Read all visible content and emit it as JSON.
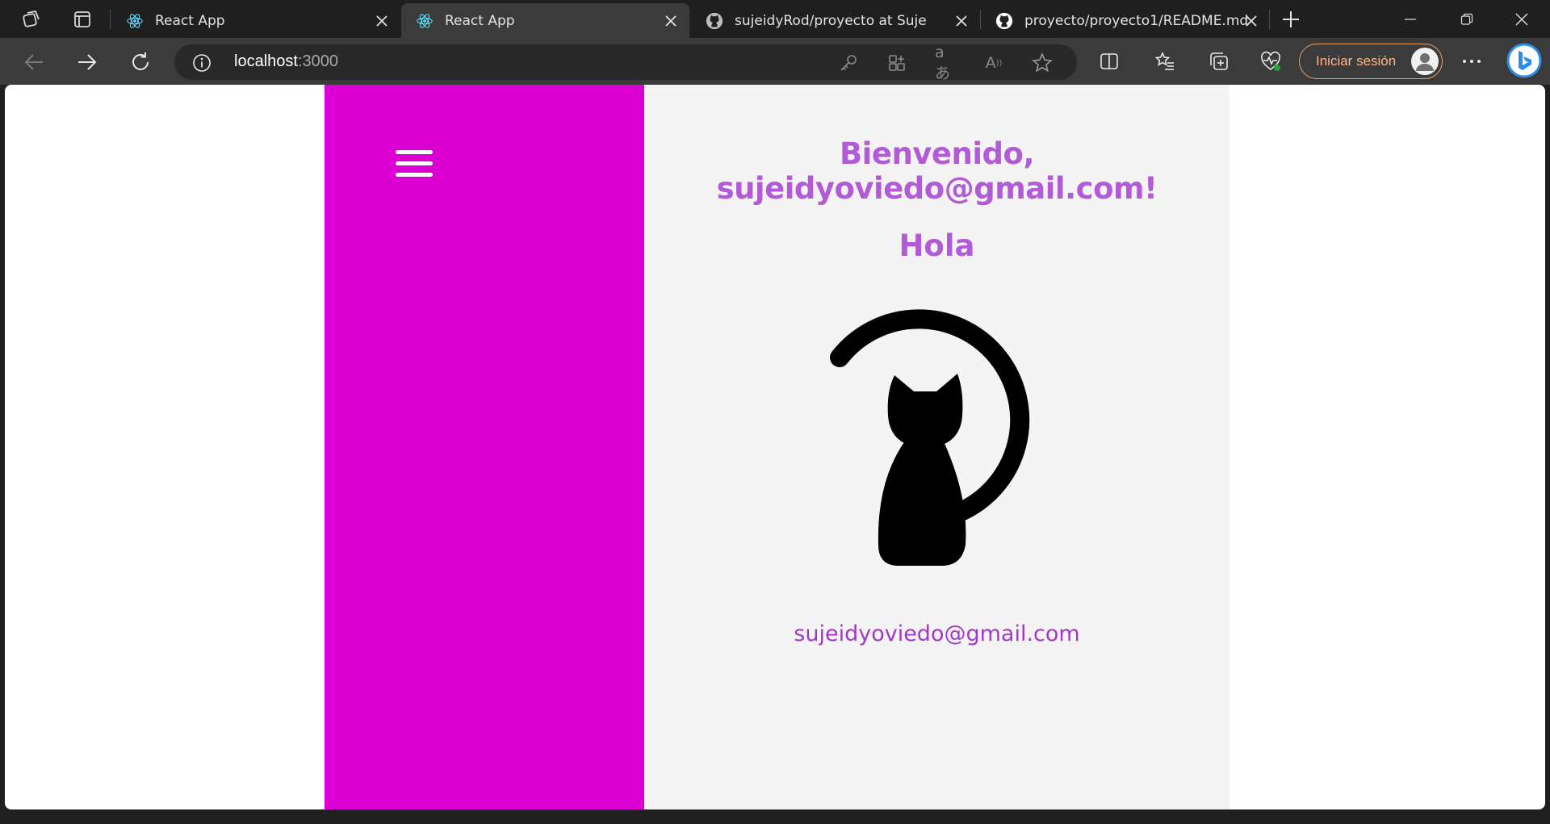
{
  "browser": {
    "tabs": [
      {
        "title": "React App",
        "favicon": "react-icon",
        "active": false
      },
      {
        "title": "React App",
        "favicon": "react-icon",
        "active": true
      },
      {
        "title": "sujeidyRod/proyecto at Suje",
        "favicon": "github-icon",
        "active": false
      },
      {
        "title": "proyecto/proyecto1/README.md",
        "favicon": "github-icon",
        "active": false
      }
    ],
    "url_host": "localhost",
    "url_port": ":3000",
    "signin_label": "Iniciar sesión"
  },
  "page": {
    "welcome": "Bienvenido, sujeidyoviedo@gmail.com!",
    "greeting": "Hola",
    "email": "sujeidyoviedo@gmail.com",
    "logo_icon": "cat-icon"
  },
  "colors": {
    "sidebar": "#da00d3",
    "heading": "#b35ad6",
    "email": "#a438c8",
    "content_bg": "#f4f4f4",
    "signin_border": "#e8a06b"
  }
}
